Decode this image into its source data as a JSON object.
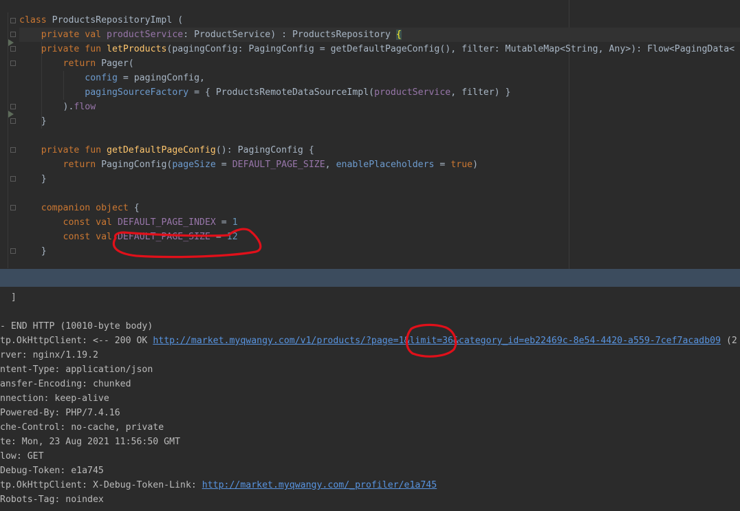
{
  "editor": {
    "line1": {
      "kw": "class",
      "name": " ProductsRepositoryImpl ("
    },
    "line2": {
      "kw1": "private val ",
      "prop": "productService",
      "rest": ": ProductService) : ProductsRepository ",
      "brace": "{"
    },
    "line3": {
      "kw": "private fun ",
      "fn": "letProducts",
      "rest": "(pagingConfig: PagingConfig = getDefaultPageConfig(), filter: MutableMap<String, Any>): Flow<PagingData<"
    },
    "line4": {
      "kw": "return ",
      "rest": "Pager("
    },
    "line5": {
      "param": "config",
      "rest": " = pagingConfig,"
    },
    "line6": {
      "param": "pagingSourceFactory",
      "rest1": " = { ProductsRemoteDataSourceImpl(",
      "prop": "productService",
      "rest2": ", filter) }"
    },
    "line7": {
      "rest": ").",
      "prop": "flow"
    },
    "line8": {
      "rest": "}"
    },
    "line10": {
      "kw": "private fun ",
      "fn": "getDefaultPageConfig",
      "rest": "(): PagingConfig {"
    },
    "line11": {
      "kw": "return ",
      "rest1": "PagingConfig(",
      "param1": "pageSize",
      "rest2": " = ",
      "prop": "DEFAULT_PAGE_SIZE",
      "rest3": ", ",
      "param2": "enablePlaceholders",
      "rest4": " = ",
      "kw2": "true",
      "rest5": ")"
    },
    "line12": {
      "rest": "}"
    },
    "line14": {
      "kw": "companion object",
      "rest": " {"
    },
    "line15": {
      "kw": "const val ",
      "prop": "DEFAULT_PAGE_INDEX",
      "rest": " = ",
      "num": "1"
    },
    "line16": {
      "kw": "const val ",
      "prop": "DEFAULT_PAGE_SIZE",
      "rest": " = ",
      "num": "12"
    },
    "line17": {
      "rest": "}"
    }
  },
  "console": {
    "line0": "  ]",
    "line1": "- END HTTP (10010-byte body)",
    "line2": {
      "text": "tp.OkHttpClient: <-- 200 OK ",
      "url": "http://market.myqwangy.com/v1/products/?page=1&limit=36&category_id=eb22469c-8e54-4420-a559-7cef7acadb09",
      "tail": " (2"
    },
    "line3": "rver: nginx/1.19.2",
    "line4": "ntent-Type: application/json",
    "line5": "ansfer-Encoding: chunked",
    "line6": "nnection: keep-alive",
    "line7": "Powered-By: PHP/7.4.16",
    "line8": "che-Control: no-cache, private",
    "line9": "te: Mon, 23 Aug 2021 11:56:50 GMT",
    "line10": "low: GET",
    "line11": "Debug-Token: e1a745",
    "line12": {
      "text": "tp.OkHttpClient: X-Debug-Token-Link: ",
      "url": "http://market.myqwangy.com/_profiler/e1a745"
    },
    "line13": "Robots-Tag: noindex"
  },
  "colors": {
    "annotation": "#e0101a",
    "divider": "#3c4c5e",
    "background": "#2b2b2b"
  }
}
